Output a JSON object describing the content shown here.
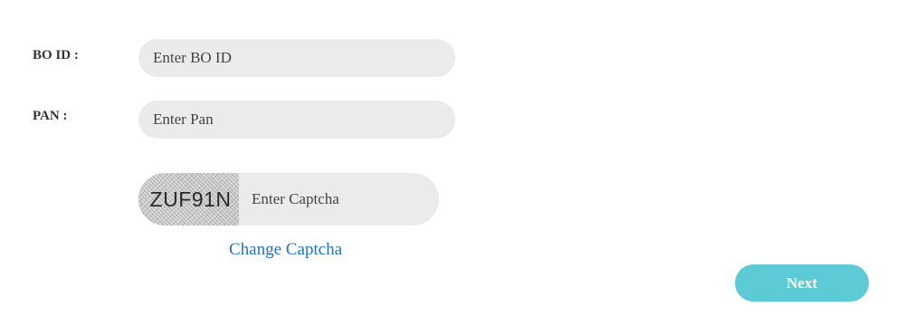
{
  "form": {
    "bo_id": {
      "label": "BO ID :",
      "placeholder": "Enter BO ID",
      "value": ""
    },
    "pan": {
      "label": "PAN :",
      "placeholder": "Enter Pan",
      "value": ""
    },
    "captcha": {
      "code": "ZUF91N",
      "placeholder": "Enter Captcha",
      "value": "",
      "change_label": "Change Captcha"
    },
    "next_label": "Next"
  },
  "colors": {
    "input_background": "#ebebeb",
    "link": "#1f72c4",
    "button": "#5ccbd6",
    "button_text": "#ffffff",
    "label_text": "#333333"
  }
}
